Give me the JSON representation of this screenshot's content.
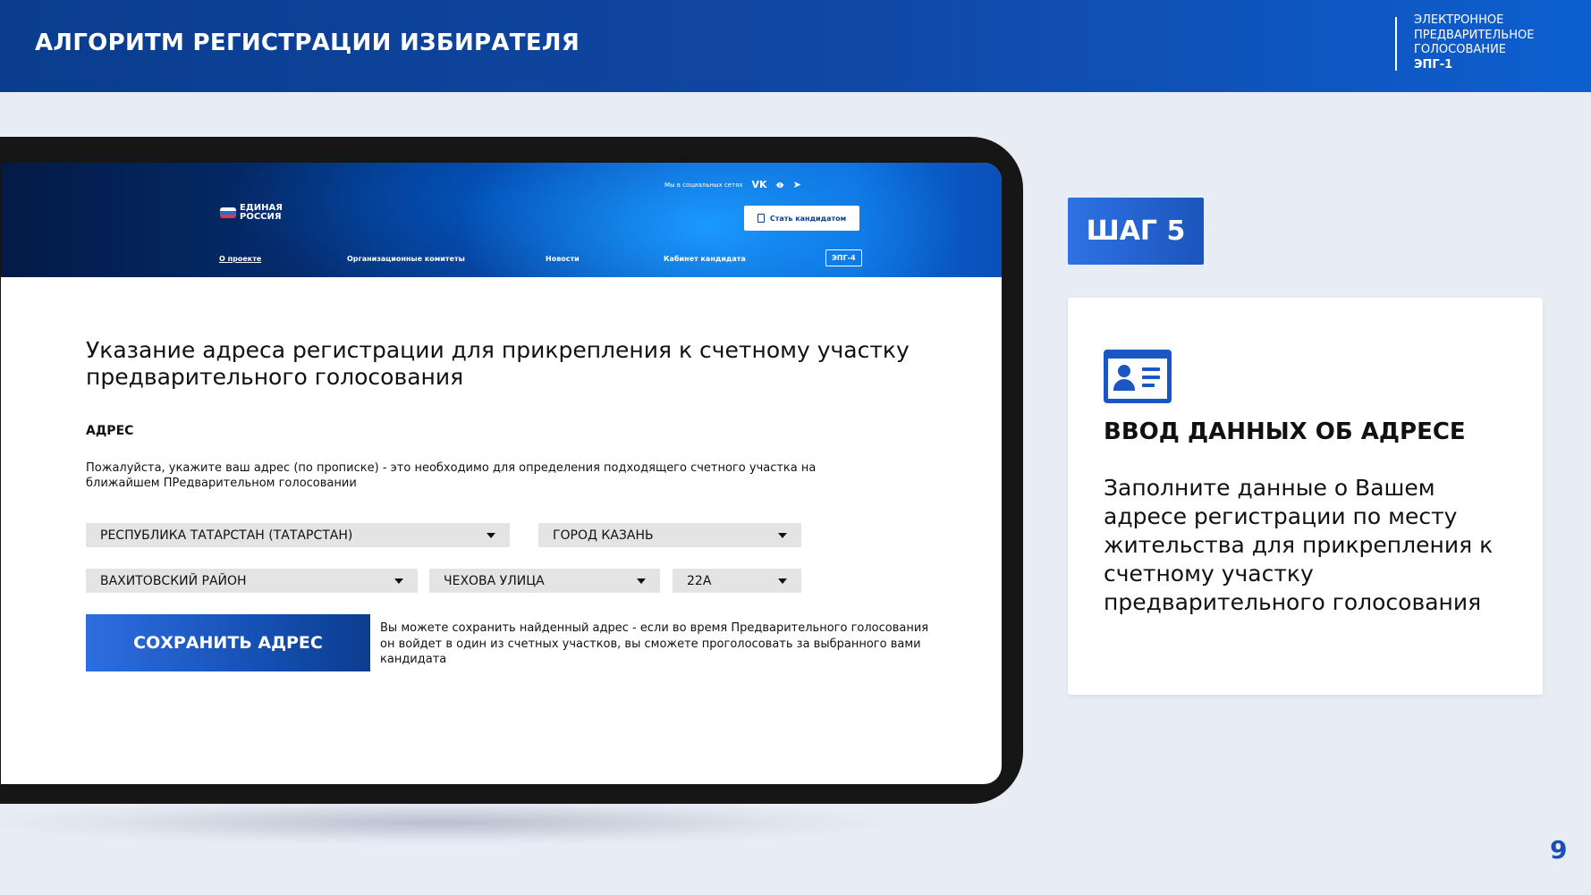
{
  "header": {
    "title": "АЛГОРИТМ РЕГИСТРАЦИИ ИЗБИРАТЕЛЯ",
    "brand_line1": "ЭЛЕКТРОННОЕ",
    "brand_line2": "ПРЕДВАРИТЕЛЬНОЕ",
    "brand_line3": "ГОЛОСОВАНИЕ",
    "brand_line4": "ЭПГ-1"
  },
  "site": {
    "logo_line1": "ЕДИНАЯ",
    "logo_line2": "РОССИЯ",
    "social_label": "Мы в социальных сетях",
    "cta_label": "Стать кандидатом",
    "nav": [
      "О проекте",
      "Организационные комитеты",
      "Новости",
      "Кабинет кандидата",
      "ЭПГ-4"
    ]
  },
  "form": {
    "heading": "Указание адреса регистрации для прикрепления к счетному участку предварительного голосования",
    "address_label": "АДРЕС",
    "hint": "Пожалуйста, укажите ваш адрес (по прописке) - это необходимо для определения подходящего счетного участка на ближайшем ПРедварительном голосовании",
    "region": "РЕСПУБЛИКА ТАТАРСТАН (ТАТАРСТАН)",
    "city": "ГОРОД КАЗАНЬ",
    "district": "ВАХИТОВСКИЙ РАЙОН",
    "street": "ЧЕХОВА УЛИЦА",
    "house": "22А",
    "save_label": "СОХРАНИТЬ АДРЕС",
    "save_note": "Вы можете сохранить найденный адрес - если во время Предварительного голосования он войдет в один из счетных участков, вы сможете проголосовать за выбранного вами кандидата"
  },
  "step": {
    "badge": "ШАГ 5",
    "title": "ВВОД ДАННЫХ ОБ АДРЕСЕ",
    "text": "Заполните данные о Вашем адресе регистрации по месту жительства для прикрепления к счетному участку предварительного голосования",
    "icon": "id-card-icon"
  },
  "page_number": "9",
  "colors": {
    "accent": "#1a56c4",
    "header_dark": "#0a3d8e",
    "background": "#e8ecf5"
  }
}
